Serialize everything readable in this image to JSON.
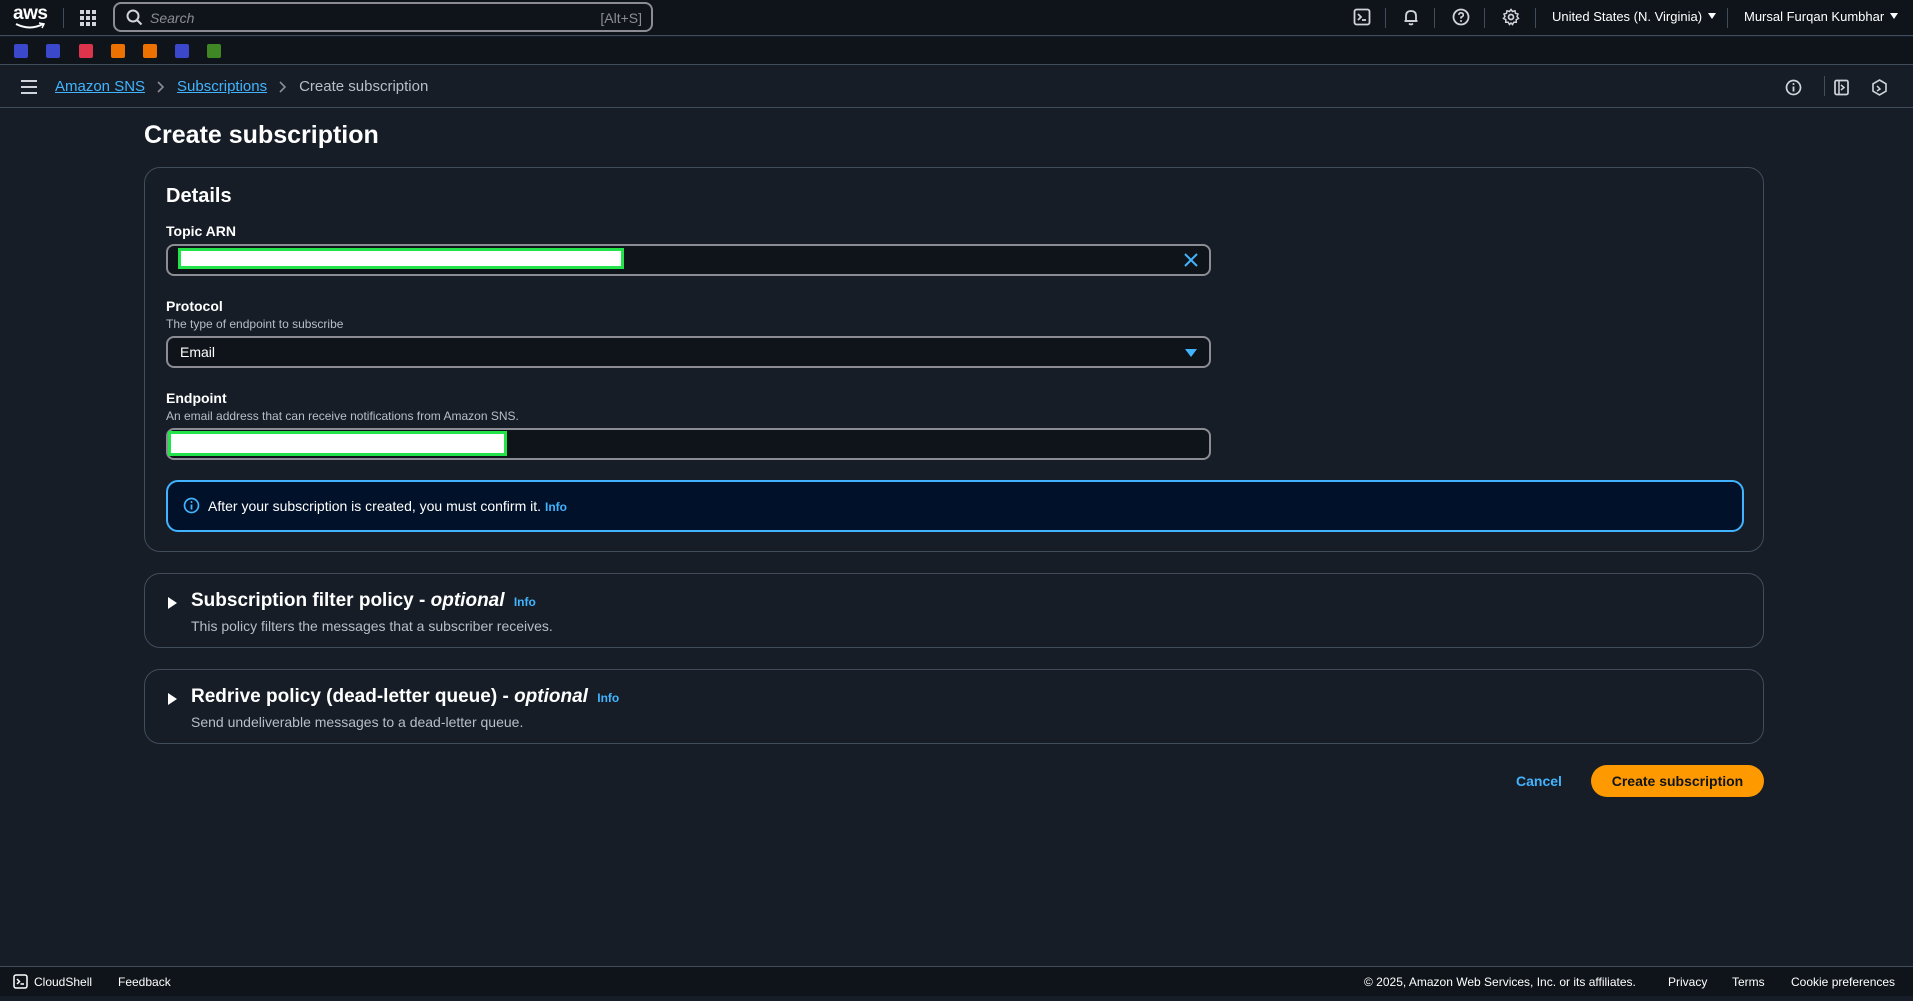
{
  "topnav": {
    "logo_text": "aws",
    "search_placeholder": "Search",
    "search_shortcut": "[Alt+S]",
    "region": "United States (N. Virginia)",
    "user": "Mursal Furqan Kumbhar",
    "icons": [
      "cloudshell-icon",
      "bell-icon",
      "help-icon",
      "settings-icon"
    ]
  },
  "favorites": {
    "colors": [
      "#3b48cc",
      "#3b48cc",
      "#dd344c",
      "#ed7100",
      "#ed7100",
      "#3b48cc",
      "#3f8624"
    ]
  },
  "breadcrumb": {
    "items": [
      "Amazon SNS",
      "Subscriptions"
    ],
    "current": "Create subscription"
  },
  "page": {
    "title": "Create subscription"
  },
  "details": {
    "heading": "Details",
    "topic_arn_label": "Topic ARN",
    "protocol_label": "Protocol",
    "protocol_desc": "The type of endpoint to subscribe",
    "protocol_value": "Email",
    "endpoint_label": "Endpoint",
    "endpoint_desc": "An email address that can receive notifications from Amazon SNS.",
    "alert_text": "After your subscription is created, you must confirm it.",
    "alert_info": "Info"
  },
  "filter_policy": {
    "title": "Subscription filter policy -",
    "optional": "optional",
    "info": "Info",
    "desc": "This policy filters the messages that a subscriber receives."
  },
  "redrive_policy": {
    "title": "Redrive policy (dead-letter queue) -",
    "optional": "optional",
    "info": "Info",
    "desc": "Send undeliverable messages to a dead-letter queue."
  },
  "actions": {
    "cancel": "Cancel",
    "create": "Create subscription"
  },
  "footer": {
    "cloudshell": "CloudShell",
    "feedback": "Feedback",
    "copyright": "© 2025, Amazon Web Services, Inc. or its affiliates.",
    "privacy": "Privacy",
    "terms": "Terms",
    "cookie": "Cookie preferences"
  },
  "colors": {
    "accent": "#42b4ff",
    "primary_button": "#ff9900",
    "background": "#161d26"
  }
}
